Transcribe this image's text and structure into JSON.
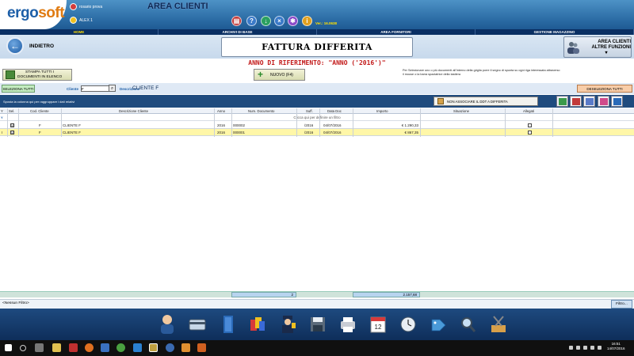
{
  "header": {
    "logo_part1": "ergo",
    "logo_part2": "soft",
    "users": [
      "rosario prova",
      "ALEX 1"
    ],
    "area_title": "AREA CLIENTI",
    "version": "Ver.: 16.0638",
    "toolbar_icons": [
      "contacts-icon",
      "help-icon",
      "download-icon",
      "close-icon",
      "settings-icon",
      "info-icon"
    ]
  },
  "nav": {
    "items": [
      "HOME",
      "ARCHIVI DI BASE",
      "AREA FORNITORI",
      "GESTIONE MAGAZZINO"
    ]
  },
  "titlebar": {
    "back_label": "INDIETRO",
    "page_title": "FATTURA DIFFERITA",
    "altre_line1": "AREA CLIENTI",
    "altre_line2": "ALTRE FUNZIONI",
    "altre_line3": "▾"
  },
  "anno": "ANNO DI RIFERIMENTO: \"ANNO ('2016')\"",
  "actions": {
    "stampa_line1": "STAMPA TUTTI I",
    "stampa_line2": "DOCUMENTI IN ELENCO",
    "nuovo_label": "NUOVO (F4)",
    "info_text": "Per Selezionare uno o più documenti all'interno della griglia porre il segno di spunta su ogni riga interessata attraverso il mouse o la barra spaziatrice della tastiera"
  },
  "filters": {
    "select_all": "SELEZIONA TUTTI",
    "cliente_label": "Cliente",
    "cliente_value": "F",
    "descrizione_label": "Descrizione",
    "descrizione_value": "CLIENTE F",
    "deselect_all": "DESELEZIONA TUTTI"
  },
  "grid": {
    "group_hint": "Sposta la colonna qui per raggruppare i dati relativi",
    "non_associa": "NON ASSOCIARE IL DDT A DIFFERITA",
    "columns": [
      "Sel.",
      "Cod. Cliente",
      "Descrizione Cliente",
      "Anno",
      "Num. Documento",
      "Suff.",
      "Data Doc",
      "Importo",
      "Situazione",
      "Allegati"
    ],
    "filter_hint": "Clicca qui per definire un filtro",
    "filter_icon": "Y",
    "rows": [
      {
        "marker": "",
        "sel": "☑",
        "cod": "F",
        "desc": "CLIENTE F",
        "anno": "2016",
        "num": "000002",
        "suff": "/2016",
        "data": "04/07/2016",
        "importo": "€ 1.290,33",
        "situazione": "",
        "allegati": ""
      },
      {
        "marker": "I",
        "sel": "☑",
        "cod": "F",
        "desc": "CLIENTE F",
        "anno": "2016",
        "num": "000001",
        "suff": "/2016",
        "data": "04/07/2016",
        "importo": "€ 867,35",
        "situazione": "",
        "allegati": ""
      }
    ]
  },
  "totals": {
    "count": "2",
    "amount": "2.157,68"
  },
  "status": {
    "filter_text": "<Nessun Filtro>",
    "filtro_button": "Filtro..."
  },
  "bottom_icons": [
    "person-icon",
    "credit-card-icon",
    "book-icon",
    "colors-icon",
    "police-icon",
    "floppy-icon",
    "printer-icon",
    "calendar-icon",
    "clock-icon",
    "tag-icon",
    "magnifier-icon",
    "tools-icon"
  ],
  "taskbar": {
    "time": "16:51",
    "date": "14/07/2016"
  }
}
